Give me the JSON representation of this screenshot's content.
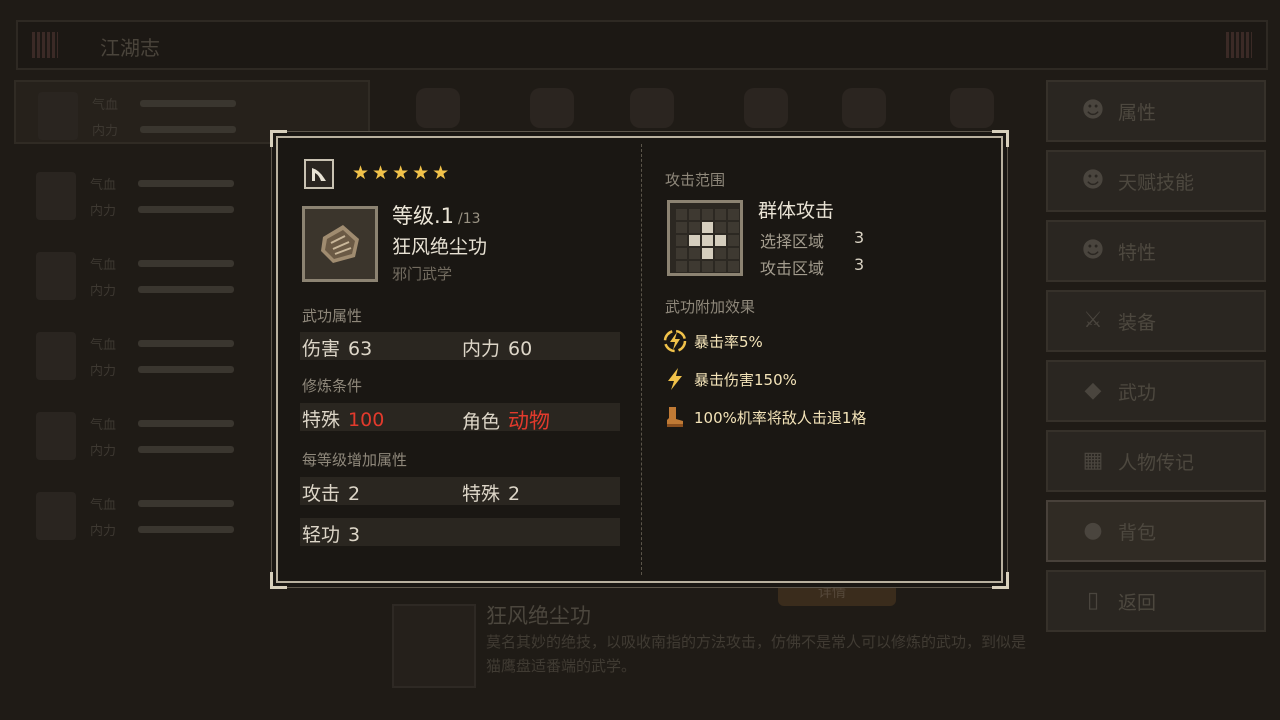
{
  "background": {
    "header_title": "江湖志",
    "characters": [
      {
        "label_a": "气血",
        "label_b": "内力",
        "value_a": "",
        "value_b": ""
      },
      {
        "label_a": "气血",
        "label_b": "内力",
        "value_a": "",
        "value_b": ""
      },
      {
        "label_a": "气血",
        "label_b": "内力",
        "value_a": "",
        "value_b": ""
      },
      {
        "label_a": "气血",
        "label_b": "内力",
        "value_a": "",
        "value_b": ""
      },
      {
        "label_a": "气血",
        "label_b": "内力",
        "value_a": "",
        "value_b": ""
      },
      {
        "label_a": "气血",
        "label_b": "内力",
        "value_a": "",
        "value_b": ""
      }
    ],
    "side_menu": [
      {
        "label": "属性",
        "icon": "person-icon"
      },
      {
        "label": "天赋技能",
        "icon": "talent-icon"
      },
      {
        "label": "特性",
        "icon": "trait-icon"
      },
      {
        "label": "装备",
        "icon": "sword-icon"
      },
      {
        "label": "武功",
        "icon": "manual-icon"
      },
      {
        "label": "人物传记",
        "icon": "book-icon"
      },
      {
        "label": "背包",
        "icon": "bag-icon"
      },
      {
        "label": "返回",
        "icon": "door-icon"
      }
    ],
    "learn_button": "详情",
    "description": {
      "name": "狂风绝尘功",
      "text": "莫名其妙的绝技，以吸收南指的方法攻击，仿佛不是常人可以修炼的武功，到似是猫鹰盘适番端的武学。"
    }
  },
  "popup": {
    "type_icon": "wind-type-icon",
    "stars": "★★★★★",
    "star_count": 5,
    "level_label": "等级.1",
    "level_max": "/13",
    "skill_name": "狂风绝尘功",
    "skill_school": "邪门武学",
    "attributes_title": "武功属性",
    "attributes": [
      {
        "name": "伤害",
        "value": "63"
      },
      {
        "name": "内力",
        "value": "60"
      }
    ],
    "requirements_title": "修炼条件",
    "requirements": [
      {
        "name": "特殊",
        "value": "100"
      },
      {
        "name": "角色",
        "value": "动物"
      }
    ],
    "per_level_title": "每等级增加属性",
    "per_level": [
      {
        "name": "攻击",
        "value": "2"
      },
      {
        "name": "特殊",
        "value": "2"
      },
      {
        "name": "轻功",
        "value": "3"
      }
    ],
    "range_title": "攻击范围",
    "range_type": "群体攻击",
    "select_area_label": "选择区域",
    "select_area_value": "3",
    "attack_area_label": "攻击区域",
    "attack_area_value": "3",
    "effects_title": "武功附加效果",
    "effects": [
      {
        "icon": "lightning-circle-icon",
        "text": "暴击率5%"
      },
      {
        "icon": "lightning-icon",
        "text": "暴击伤害150%"
      },
      {
        "icon": "boot-icon",
        "text": "100%机率将敌人击退1格"
      }
    ],
    "colors": {
      "star": "#f1c24a",
      "requirement_value": "#e23a2c",
      "effect_text": "#f3e3b8"
    }
  }
}
